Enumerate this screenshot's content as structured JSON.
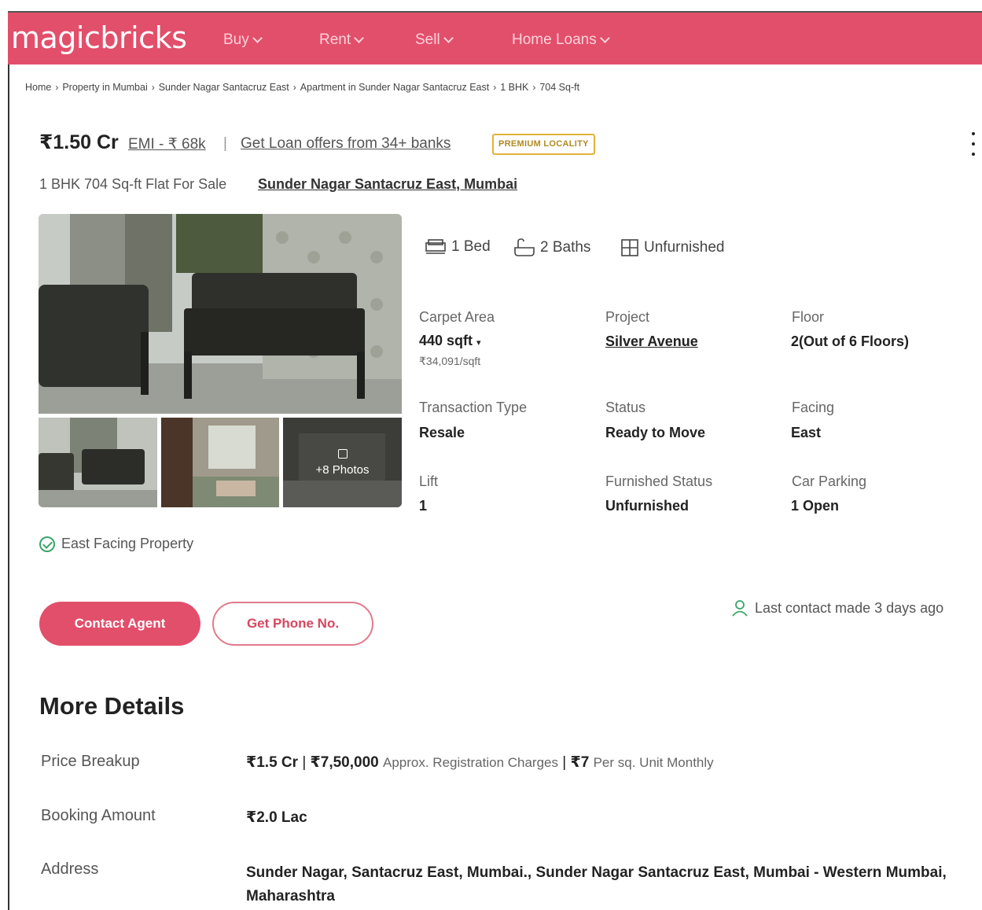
{
  "header": {
    "logo": "magicbricks",
    "nav": [
      {
        "label": "Buy"
      },
      {
        "label": "Rent"
      },
      {
        "label": "Sell"
      },
      {
        "label": "Home Loans"
      }
    ]
  },
  "breadcrumb": [
    "Home",
    "Property in Mumbai",
    "Sunder Nagar Santacruz East",
    "Apartment in Sunder Nagar Santacruz East",
    "1 BHK",
    "704 Sq-ft"
  ],
  "listing": {
    "price": "₹1.50 Cr",
    "emi": "EMI - ₹ 68k",
    "separator": "|",
    "loan_offer": "Get Loan offers from 34+ banks",
    "badge": "PREMIUM LOCALITY",
    "title": "1 BHK 704 Sq-ft Flat For Sale",
    "location": "Sunder Nagar Santacruz East, Mumbai"
  },
  "gallery": {
    "more_photos": "+8 Photos"
  },
  "amenities": {
    "beds": "1 Bed",
    "baths": "2 Baths",
    "furnishing": "Unfurnished"
  },
  "specs": {
    "carpet_area": {
      "label": "Carpet Area",
      "value": "440 sqft",
      "sub": "₹34,091/sqft"
    },
    "project": {
      "label": "Project",
      "value": "Silver Avenue"
    },
    "floor": {
      "label": "Floor",
      "value": "2(Out of 6 Floors)"
    },
    "transaction": {
      "label": "Transaction Type",
      "value": "Resale"
    },
    "status": {
      "label": "Status",
      "value": "Ready to Move"
    },
    "facing": {
      "label": "Facing",
      "value": "East"
    },
    "lift": {
      "label": "Lift",
      "value": "1"
    },
    "furnished": {
      "label": "Furnished Status",
      "value": "Unfurnished"
    },
    "parking": {
      "label": "Car Parking",
      "value": "1 Open"
    }
  },
  "facing_note": "East Facing Property",
  "actions": {
    "contact_agent": "Contact Agent",
    "get_phone": "Get Phone No.",
    "last_contact": "Last contact made 3 days ago"
  },
  "more_details": {
    "title": "More Details",
    "price_breakup": {
      "label": "Price Breakup",
      "price": "₹1.5 Cr",
      "sep1": "|",
      "registration": "₹7,50,000",
      "registration_note": "Approx. Registration Charges",
      "sep2": "|",
      "maintenance": "₹7",
      "maintenance_note": "Per sq. Unit Monthly"
    },
    "booking": {
      "label": "Booking Amount",
      "value": "₹2.0 Lac"
    },
    "address": {
      "label": "Address",
      "value": "Sunder Nagar, Santacruz East, Mumbai., Sunder Nagar Santacruz East, Mumbai - Western Mumbai, Maharashtra"
    }
  },
  "colors": {
    "brand": "#e24f6b",
    "badge_border": "#e0b33a",
    "success": "#3aa56a"
  }
}
